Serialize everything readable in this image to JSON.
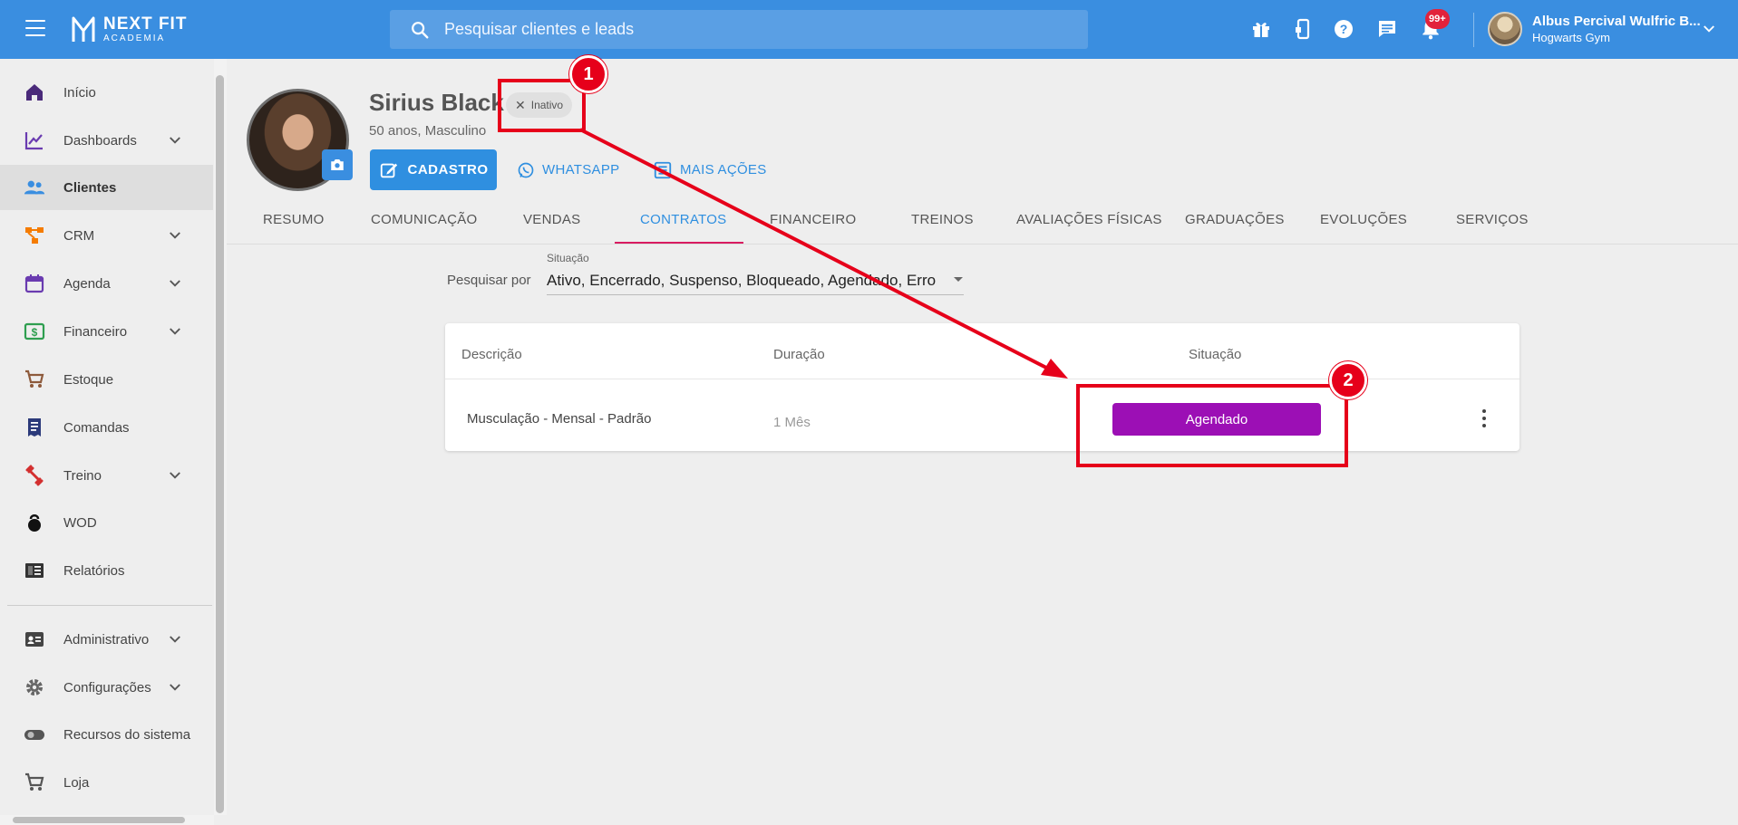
{
  "app": {
    "logo_title": "NEXT FIT",
    "logo_subtitle": "ACADEMIA"
  },
  "search": {
    "placeholder": "Pesquisar clientes e leads"
  },
  "notifications": {
    "badge": "99+"
  },
  "user": {
    "name": "Albus Percival Wulfric B...",
    "gym": "Hogwarts Gym"
  },
  "sidebar": {
    "items": [
      {
        "label": "Início",
        "icon": "home-icon"
      },
      {
        "label": "Dashboards",
        "icon": "chart-line-icon",
        "expandable": true
      },
      {
        "label": "Clientes",
        "icon": "people-icon",
        "active": true
      },
      {
        "label": "CRM",
        "icon": "crm-flow-icon",
        "expandable": true
      },
      {
        "label": "Agenda",
        "icon": "calendar-icon",
        "expandable": true
      },
      {
        "label": "Financeiro",
        "icon": "money-icon",
        "expandable": true
      },
      {
        "label": "Estoque",
        "icon": "cart-icon"
      },
      {
        "label": "Comandas",
        "icon": "receipt-icon"
      },
      {
        "label": "Treino",
        "icon": "dumbbell-icon",
        "expandable": true
      },
      {
        "label": "WOD",
        "icon": "kettlebell-icon"
      },
      {
        "label": "Relatórios",
        "icon": "report-icon"
      },
      {
        "label": "Administrativo",
        "icon": "id-card-icon",
        "expandable": true
      },
      {
        "label": "Configurações",
        "icon": "gear-icon",
        "expandable": true
      },
      {
        "label": "Recursos do sistema",
        "icon": "toggle-icon"
      },
      {
        "label": "Loja",
        "icon": "cart-icon"
      }
    ]
  },
  "client": {
    "name": "Sirius Black",
    "status": "Inativo",
    "info": "50 anos, Masculino",
    "actions": {
      "cadastro": "CADASTRO",
      "whatsapp": "WHATSAPP",
      "mais_acoes": "MAIS AÇÕES"
    }
  },
  "tabs": [
    "RESUMO",
    "COMUNICAÇÃO",
    "VENDAS",
    "CONTRATOS",
    "FINANCEIRO",
    "TREINOS",
    "AVALIAÇÕES FÍSICAS",
    "GRADUAÇÕES",
    "EVOLUÇÕES",
    "SERVIÇOS"
  ],
  "active_tab": "CONTRATOS",
  "filter": {
    "label": "Pesquisar por",
    "field_label": "Situação",
    "value": "Ativo, Encerrado, Suspenso, Bloqueado, Agendado, Erro"
  },
  "table": {
    "headers": {
      "descricao": "Descrição",
      "duracao": "Duração",
      "situacao": "Situação"
    },
    "rows": [
      {
        "descricao": "Musculação - Mensal - Padrão",
        "duracao": "1 Mês",
        "situacao": "Agendado"
      }
    ]
  },
  "annotations": [
    "1",
    "2"
  ],
  "colors": {
    "topbar": "#3a8ee0",
    "accent": "#2f8fe0",
    "tab_underline": "#d81b60",
    "status_agendado": "#9c0fb5",
    "annotation": "#e6001a"
  }
}
